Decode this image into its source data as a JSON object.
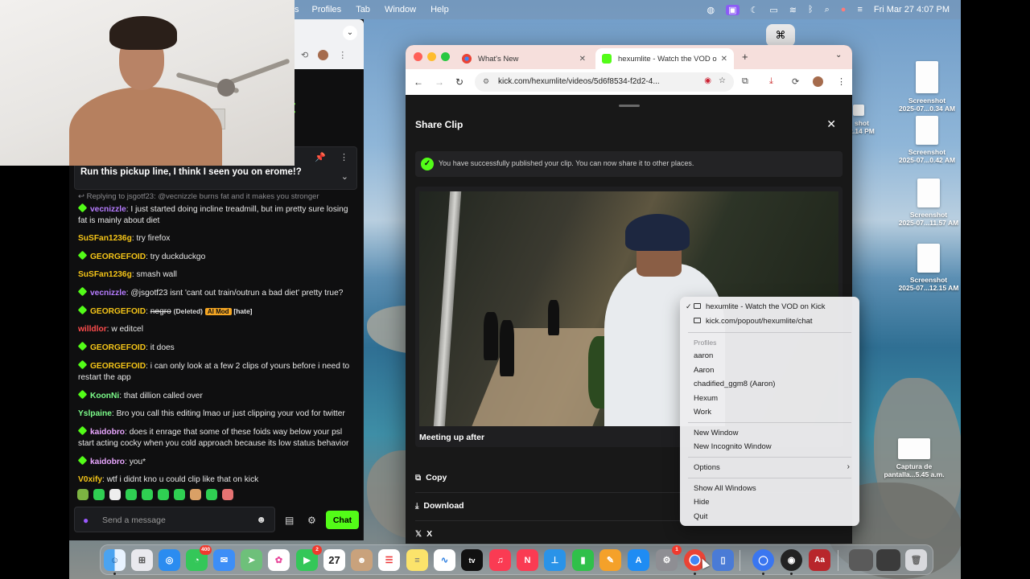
{
  "menubar": {
    "items": [
      "s",
      "Profiles",
      "Tab",
      "Window",
      "Help"
    ],
    "clock": "Fri Mar 27  4:07 PM"
  },
  "chat": {
    "pinned_message": "Run this pickup line, I think I seen you on erome!?",
    "reply_hint": "Replying to jsgotf23: @vecnizzle burns fat and it makes you stronger",
    "messages": [
      {
        "user": "vecnizzle",
        "color": "#b67cff",
        "badge": true,
        "text": "I just started doing incline treadmill, but im pretty sure losing fat is mainly about diet"
      },
      {
        "user": "SuSFan1236g",
        "color": "#f5c518",
        "badge": false,
        "text": "try firefox"
      },
      {
        "user": "GEORGEFOID",
        "color": "#f5c518",
        "badge": true,
        "text": "try duckduckgo"
      },
      {
        "user": "SuSFan1236g",
        "color": "#f5c518",
        "badge": false,
        "text": "smash wall"
      },
      {
        "user": "vecnizzle",
        "color": "#b67cff",
        "badge": true,
        "text": "@jsgotf23 isnt 'cant out train/outrun a bad diet' pretty true?"
      },
      {
        "user": "GEORGEFOID",
        "color": "#f5c518",
        "badge": true,
        "text": "negro",
        "deleted": "(Deleted)",
        "ai_mod": "AI Mod",
        "reason": "[hate]"
      },
      {
        "user": "willdlor",
        "color": "#ff4d4d",
        "badge": false,
        "text": "w editcel"
      },
      {
        "user": "GEORGEFOID",
        "color": "#f5c518",
        "badge": true,
        "text": "it does"
      },
      {
        "user": "GEORGEFOID",
        "color": "#f5c518",
        "badge": true,
        "text": "i can only look at a few 2 clips of yours before i need to restart the app"
      },
      {
        "user": "KoonNi",
        "color": "#7cfc8a",
        "badge": true,
        "text": "that dillion called over"
      },
      {
        "user": "Yslpaine",
        "color": "#7cfc8a",
        "badge": false,
        "text": "Bro you call this editing lmao ur just clipping your vod for twitter"
      },
      {
        "user": "kaidobro",
        "color": "#e9a6ff",
        "badge": true,
        "text": "does it enrage that some of these foids way below your psl start acting cocky when you cold approach because its low status behavior"
      },
      {
        "user": "kaidobro",
        "color": "#e9a6ff",
        "badge": true,
        "text": "you*"
      },
      {
        "user": "V0xify",
        "color": "#f5c518",
        "badge": false,
        "text": "wtf i didnt kno u could clip like that on kick"
      }
    ],
    "composer_placeholder": "Send a message",
    "send_label": "Chat"
  },
  "browser": {
    "tabs": [
      {
        "title": "What's New",
        "icon": "chrome-icon"
      },
      {
        "title": "hexumlite - Watch the VOD o",
        "icon": "kick-icon"
      }
    ],
    "url": "kick.com/hexumlite/videos/5d6f8534-f2d2-4..."
  },
  "share_clip": {
    "title": "Share Clip",
    "success_text": "You have successfully published your clip. You can now share it to other places.",
    "clip_title": "Meeting up after",
    "options": [
      "Copy",
      "Download",
      "X"
    ]
  },
  "context_menu": {
    "windows": [
      "hexumlite - Watch the VOD on Kick",
      "kick.com/popout/hexumlite/chat"
    ],
    "profiles_header": "Profiles",
    "profiles": [
      "aaron",
      "Aaron",
      "chadified_ggm8 (Aaron)",
      "Hexum",
      "Work"
    ],
    "actions1": [
      "New Window",
      "New Incognito Window"
    ],
    "options": "Options",
    "actions2": [
      "Show All Windows",
      "Hide",
      "Quit"
    ]
  },
  "dock": {
    "messages_badge": "400",
    "facetime_badge": "2",
    "calendar_day": "27",
    "settings_badge": "1"
  },
  "desktop_files": [
    {
      "name": "Screenshot",
      "sub": "2025-07...0.34 AM"
    },
    {
      "name": "Screenshot",
      "sub": "2025-07...0.42 AM"
    },
    {
      "name": "Screenshot",
      "sub": "2025-07...11.57 AM"
    },
    {
      "name": "Screenshot",
      "sub": "2025-07...12.15 AM"
    },
    {
      "name": "Captura de",
      "sub": "pantalla...5.45 a.m."
    },
    {
      "name": "shot",
      "sub": "2.14 PM"
    }
  ]
}
